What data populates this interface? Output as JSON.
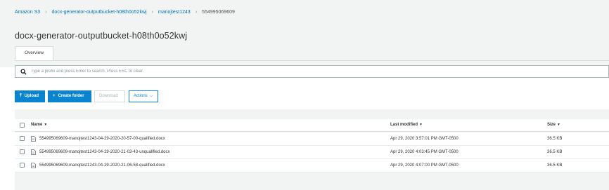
{
  "breadcrumb": {
    "root": "Amazon S3",
    "bucket": "docx-generator-outputbucket-h08th0o52kwj",
    "folder": "manojtest1243",
    "current": "554995069609"
  },
  "page_title": "docx-generator-outputbucket-h08th0o52kwj",
  "tabs": {
    "overview": "Overview"
  },
  "search": {
    "placeholder": "Type a prefix and press Enter to search. Press ESC to clear.",
    "value": ""
  },
  "toolbar": {
    "upload": "Upload",
    "create_folder": "Create folder",
    "download": "Download",
    "actions": "Actions"
  },
  "table": {
    "headers": {
      "name": "Name",
      "last_modified": "Last modified",
      "size": "Size"
    },
    "rows": [
      {
        "name": "554995069609-manojtest1243-04-29-2020-20-57-00-qualified.docx",
        "last_modified": "Apr 29, 2020 3:57:01 PM GMT-0500",
        "size": "36.5 KB"
      },
      {
        "name": "554995069609-manojtest1243-04-29-2020-21-03-43-unqualified.docx",
        "last_modified": "Apr 29, 2020 4:03:45 PM GMT-0500",
        "size": "36.5 KB"
      },
      {
        "name": "554995069609-manojtest1243-04-29-2020-21-06-58-qualified.docx",
        "last_modified": "Apr 29, 2020 4:07:00 PM GMT-0500",
        "size": "36.5 KB"
      }
    ]
  },
  "colors": {
    "accent": "#0a84ce",
    "link": "#0073bb",
    "background_band": "#f2f3f3"
  },
  "icons": {
    "search": "search-icon",
    "upload": "upload-icon",
    "create_folder": "plus-icon",
    "file": "file-icon",
    "sort": "caret-down-icon",
    "actions": "chevron-down-icon"
  }
}
